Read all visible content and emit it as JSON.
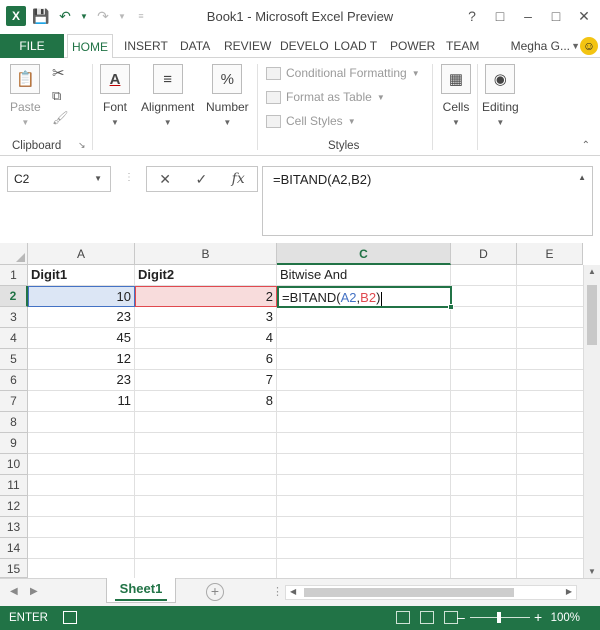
{
  "window": {
    "title": "Book1 - Microsoft Excel Preview"
  },
  "qat": {
    "logo": "X"
  },
  "ribbon_tabs": [
    "FILE",
    "HOME",
    "INSERT",
    "DATA",
    "REVIEW",
    "DEVELO",
    "LOAD T",
    "POWER",
    "TEAM"
  ],
  "user": {
    "name": "Megha G..."
  },
  "ribbon": {
    "paste": "Paste",
    "clipboard": "Clipboard",
    "font": "Font",
    "alignment": "Alignment",
    "number": "Number",
    "number_icon": "%",
    "conditional_formatting": "Conditional Formatting",
    "format_as_table": "Format as Table",
    "cell_styles": "Cell Styles",
    "styles": "Styles",
    "cells": "Cells",
    "editing": "Editing"
  },
  "formula_bar": {
    "name_box": "C2",
    "formula": "=BITAND(A2,B2)"
  },
  "columns": [
    "A",
    "B",
    "C",
    "D",
    "E"
  ],
  "rows": [
    "1",
    "2",
    "3",
    "4",
    "5",
    "6",
    "7",
    "8",
    "9",
    "10",
    "11",
    "12",
    "13",
    "14",
    "15"
  ],
  "sheet": {
    "headers": {
      "a": "Digit1",
      "b": "Digit2",
      "c": "Bitwise And"
    },
    "data": [
      {
        "a": "10",
        "b": "2"
      },
      {
        "a": "23",
        "b": "3"
      },
      {
        "a": "45",
        "b": "4"
      },
      {
        "a": "12",
        "b": "6"
      },
      {
        "a": "23",
        "b": "7"
      },
      {
        "a": "11",
        "b": "8"
      }
    ],
    "editing": {
      "prefix": "=BITAND(",
      "ref_a": "A2",
      "comma": ",",
      "ref_b": "B2",
      "suffix": ")"
    }
  },
  "sheet_tabs": {
    "active": "Sheet1"
  },
  "status_bar": {
    "mode": "ENTER",
    "zoom": "100%"
  },
  "colors": {
    "accent": "#217346",
    "ref_a": "#4472c4",
    "ref_b": "#e0494f"
  }
}
